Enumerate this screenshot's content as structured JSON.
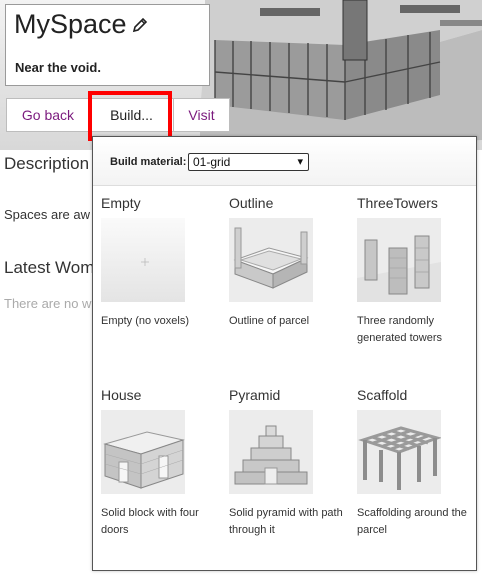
{
  "space": {
    "title": "MySpace",
    "subtitle": "Near  the void."
  },
  "tabs": {
    "back": "Go back",
    "build": "Build...",
    "visit": "Visit"
  },
  "background": {
    "description_heading": "Description",
    "description_text": "Spaces are aw",
    "latest_heading": "Latest Wom",
    "latest_empty": "There are no w"
  },
  "build_panel": {
    "material_label": "Build material:",
    "material_value": "01-grid",
    "options": [
      {
        "name": "Empty",
        "desc": "Empty (no voxels)",
        "icon": "empty-thumbnail"
      },
      {
        "name": "Outline",
        "desc": "Outline of parcel",
        "icon": "outline-thumbnail"
      },
      {
        "name": "ThreeTowers",
        "desc": "Three randomly generated towers",
        "icon": "towers-thumbnail"
      },
      {
        "name": "House",
        "desc": "Solid block with four doors",
        "icon": "house-thumbnail"
      },
      {
        "name": "Pyramid",
        "desc": "Solid pyramid with path through it",
        "icon": "pyramid-thumbnail"
      },
      {
        "name": "Scaffold",
        "desc": "Scaffolding around the parcel",
        "icon": "scaffold-thumbnail"
      }
    ]
  },
  "colors": {
    "link": "#7b1b7e",
    "highlight": "#ff0000"
  }
}
